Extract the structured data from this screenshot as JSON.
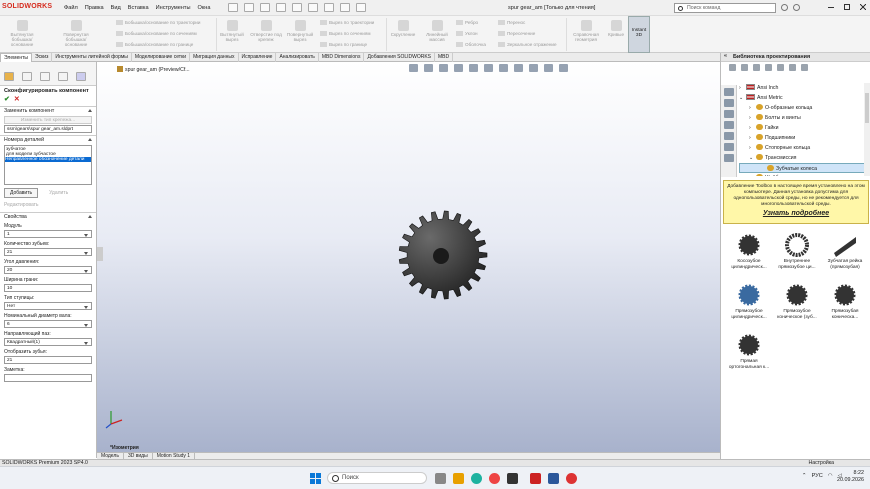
{
  "app": {
    "logo": "SOLIDWORKS",
    "menu": [
      "Файл",
      "Правка",
      "Вид",
      "Вставка",
      "Инструменты",
      "Окна"
    ],
    "doc_title": "spur gear_am [Только для чтения]",
    "search_placeholder": "Поиск команд"
  },
  "ribbon": {
    "buttons": [
      {
        "label": "Вытянутая бобышка/основание"
      },
      {
        "label": "Повернутая бобышка/основание"
      }
    ],
    "small": [
      "Бобышка/основание по траектории",
      "Бобышка/основание по сечениям",
      "Бобышка/основание по границе",
      "Вырез по траектории",
      "Вырез по сечениям",
      "Вырез по границе",
      "Ребро",
      "Уклон",
      "Оболочка",
      "Перенос",
      "Пересечение",
      "Зеркальное отражение"
    ],
    "big": [
      {
        "label": "Вытянутый вырез"
      },
      {
        "label": "Отверстие под крепеж"
      },
      {
        "label": "Повернутый вырез"
      },
      {
        "label": "Скругление"
      },
      {
        "label": "Линейный массив"
      },
      {
        "label": "Справочная геометрия"
      },
      {
        "label": "Кривые"
      }
    ],
    "instant": "Instant 3D"
  },
  "tabs": [
    "Элементы",
    "Эскиз",
    "Инструменты литейной формы",
    "Моделирование сетки",
    "Миграция данных",
    "Исправление",
    "Анализировать",
    "MBD Dimensions",
    "Добавления SOLIDWORKS",
    "MBD"
  ],
  "panel": {
    "title": "Сконфигурировать компонент",
    "ok": "✔",
    "cancel": "✕",
    "replace_section": "Заменить компонент",
    "change_type": "Изменить тип крепежа...",
    "path": "ssm\\gears\\spur gear_am.sldprt",
    "part_numbers_section": "Номера деталей",
    "list": [
      "зубчатое",
      "для модели зубчастое",
      "Неправленное обозначение детали"
    ],
    "add": "Добавить",
    "delete": "Удалить",
    "edit": "Редактировать",
    "props_section": "Свойства",
    "fields": [
      {
        "label": "Модуль",
        "value": "1",
        "type": "drop"
      },
      {
        "label": "Количество зубьев:",
        "value": "21",
        "type": "drop"
      },
      {
        "label": "Угол давления:",
        "value": "20",
        "type": "drop"
      },
      {
        "label": "Ширина грани:",
        "value": "10",
        "type": "input"
      },
      {
        "label": "Тип ступицы:",
        "value": "Нет",
        "type": "drop"
      },
      {
        "label": "Номинальный диаметр вала:",
        "value": "6",
        "type": "drop"
      },
      {
        "label": "Направляющий паз:",
        "value": "Квадратный(1)",
        "type": "drop"
      },
      {
        "label": "Отобразить зубья:",
        "value": "21",
        "type": "input"
      },
      {
        "label": "Заметка:",
        "value": "",
        "type": "input"
      }
    ]
  },
  "viewport": {
    "doc": "spur gear_am (Preview/Cf...",
    "label": "*Изометрия"
  },
  "bottom_tabs": [
    "Модель",
    "3D виды",
    "Motion Study 1"
  ],
  "library": {
    "title": "Библиотека проектирования",
    "tree": [
      {
        "label": "Ansi Inch",
        "icon": "flag",
        "indent": 0,
        "exp": "›"
      },
      {
        "label": "Ansi Metric",
        "icon": "flag",
        "indent": 0,
        "exp": "⌄"
      },
      {
        "label": "О-образные кольца",
        "icon": "ring",
        "indent": 1,
        "exp": "›"
      },
      {
        "label": "Болты и винты",
        "icon": "folder",
        "indent": 1,
        "exp": "›"
      },
      {
        "label": "Гайки",
        "icon": "folder",
        "indent": 1,
        "exp": "›"
      },
      {
        "label": "Подшипники",
        "icon": "folder",
        "indent": 1,
        "exp": "›"
      },
      {
        "label": "Стопорные кольца",
        "icon": "folder",
        "indent": 1,
        "exp": "›"
      },
      {
        "label": "Трансмиссия",
        "icon": "folder",
        "indent": 1,
        "exp": "⌄"
      },
      {
        "label": "Зубчатые колеса",
        "icon": "folder",
        "indent": 2,
        "exp": "",
        "hl": true
      },
      {
        "label": "Шайбы",
        "icon": "folder",
        "indent": 1,
        "exp": "›"
      }
    ],
    "ad_text": "Добавление Toolbox в настоящее время установлено на этом компьютере. Данная установка допустима для однопользовательской среды, но не рекомендуется для многопользовательской среды.",
    "ad_link": "Узнать подробнее",
    "items": [
      {
        "label": "Косозубое цилиндрическ..."
      },
      {
        "label": "Внутреннее прямозубое ци..."
      },
      {
        "label": "Зубчатая рейка (прямозубая)"
      },
      {
        "label": "Прямозубое цилиндрическ..."
      },
      {
        "label": "Прямозубое коническое (зуб..."
      },
      {
        "label": "Прямозубая коническа..."
      },
      {
        "label": "Прямая ортогональная к..."
      }
    ]
  },
  "status": {
    "left": "SOLIDWORKS Premium 2023 SP4.0",
    "right": "Настройка"
  },
  "taskbar": {
    "search": "Поиск",
    "lang": "РУС",
    "time": "8:22",
    "date": "20.09.2026"
  }
}
